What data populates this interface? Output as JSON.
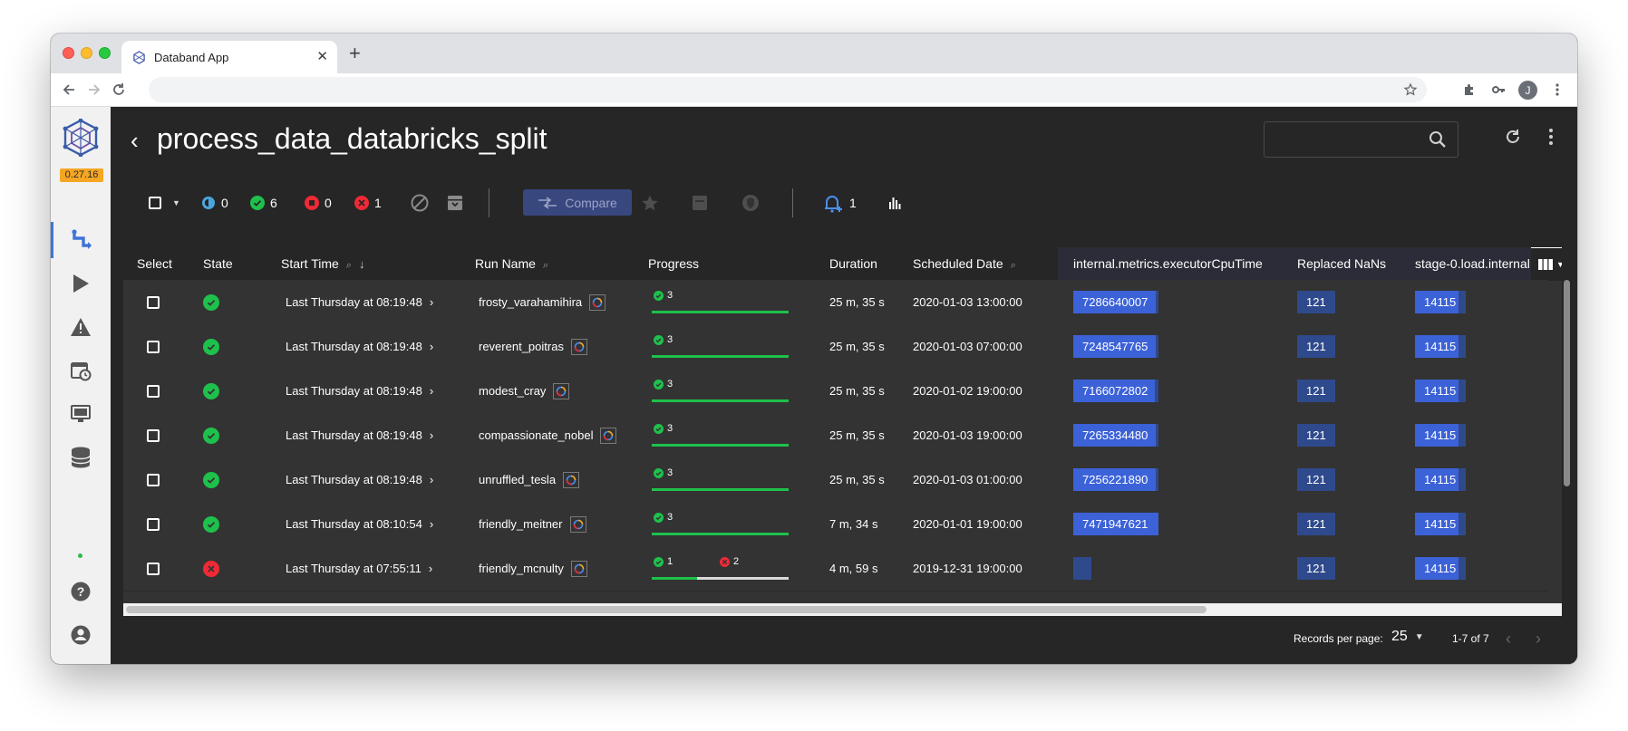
{
  "browser": {
    "tab_title": "Databand App",
    "profile_initial": "J"
  },
  "app": {
    "version": "0.27.16",
    "page_title": "process_data_databricks_split"
  },
  "actions": {
    "running_count": "0",
    "success_count": "6",
    "shutdown_count": "0",
    "failed_count": "1",
    "compare_label": "Compare",
    "alerts_count": "1"
  },
  "table": {
    "headers": {
      "select": "Select",
      "state": "State",
      "start_time": "Start Time",
      "run_name": "Run Name",
      "progress": "Progress",
      "duration": "Duration",
      "scheduled_date": "Scheduled Date",
      "metric1": "internal.metrics.executorCpuTime",
      "metric2": "Replaced NaNs",
      "metric3": "stage-0.load.internal"
    },
    "rows": [
      {
        "state": "success",
        "start_time": "Last Thursday at 08:19:48",
        "run_name": "frosty_varahamihira",
        "success": "3",
        "failed": "",
        "success_fraction": 1.0,
        "duration": "25 m, 35 s",
        "scheduled": "2020-01-03 13:00:00",
        "cpu": "7286640007",
        "nans": "121",
        "stage": "14115"
      },
      {
        "state": "success",
        "start_time": "Last Thursday at 08:19:48",
        "run_name": "reverent_poitras",
        "success": "3",
        "failed": "",
        "success_fraction": 1.0,
        "duration": "25 m, 35 s",
        "scheduled": "2020-01-03 07:00:00",
        "cpu": "7248547765",
        "nans": "121",
        "stage": "14115"
      },
      {
        "state": "success",
        "start_time": "Last Thursday at 08:19:48",
        "run_name": "modest_cray",
        "success": "3",
        "failed": "",
        "success_fraction": 1.0,
        "duration": "25 m, 35 s",
        "scheduled": "2020-01-02 19:00:00",
        "cpu": "7166072802",
        "nans": "121",
        "stage": "14115"
      },
      {
        "state": "success",
        "start_time": "Last Thursday at 08:19:48",
        "run_name": "compassionate_nobel",
        "success": "3",
        "failed": "",
        "success_fraction": 1.0,
        "duration": "25 m, 35 s",
        "scheduled": "2020-01-03 19:00:00",
        "cpu": "7265334480",
        "nans": "121",
        "stage": "14115"
      },
      {
        "state": "success",
        "start_time": "Last Thursday at 08:19:48",
        "run_name": "unruffled_tesla",
        "success": "3",
        "failed": "",
        "success_fraction": 1.0,
        "duration": "25 m, 35 s",
        "scheduled": "2020-01-03 01:00:00",
        "cpu": "7256221890",
        "nans": "121",
        "stage": "14115"
      },
      {
        "state": "success",
        "start_time": "Last Thursday at 08:10:54",
        "run_name": "friendly_meitner",
        "success": "3",
        "failed": "",
        "success_fraction": 1.0,
        "duration": "7 m, 34 s",
        "scheduled": "2020-01-01 19:00:00",
        "cpu": "7471947621",
        "nans": "121",
        "stage": "14115"
      },
      {
        "state": "failed",
        "start_time": "Last Thursday at 07:55:11",
        "run_name": "friendly_mcnulty",
        "success": "1",
        "failed": "2",
        "success_fraction": 0.33,
        "duration": "4 m, 59 s",
        "scheduled": "2019-12-31 19:00:00",
        "cpu": "",
        "nans": "121",
        "stage": "14115"
      }
    ]
  },
  "footer": {
    "records_label": "Records per page:",
    "records_value": "25",
    "range": "1-7 of 7"
  },
  "colors": {
    "success": "#1ec14b",
    "failed": "#ee2a36",
    "accent": "#3c62d8",
    "version_badge": "#f5a623"
  }
}
